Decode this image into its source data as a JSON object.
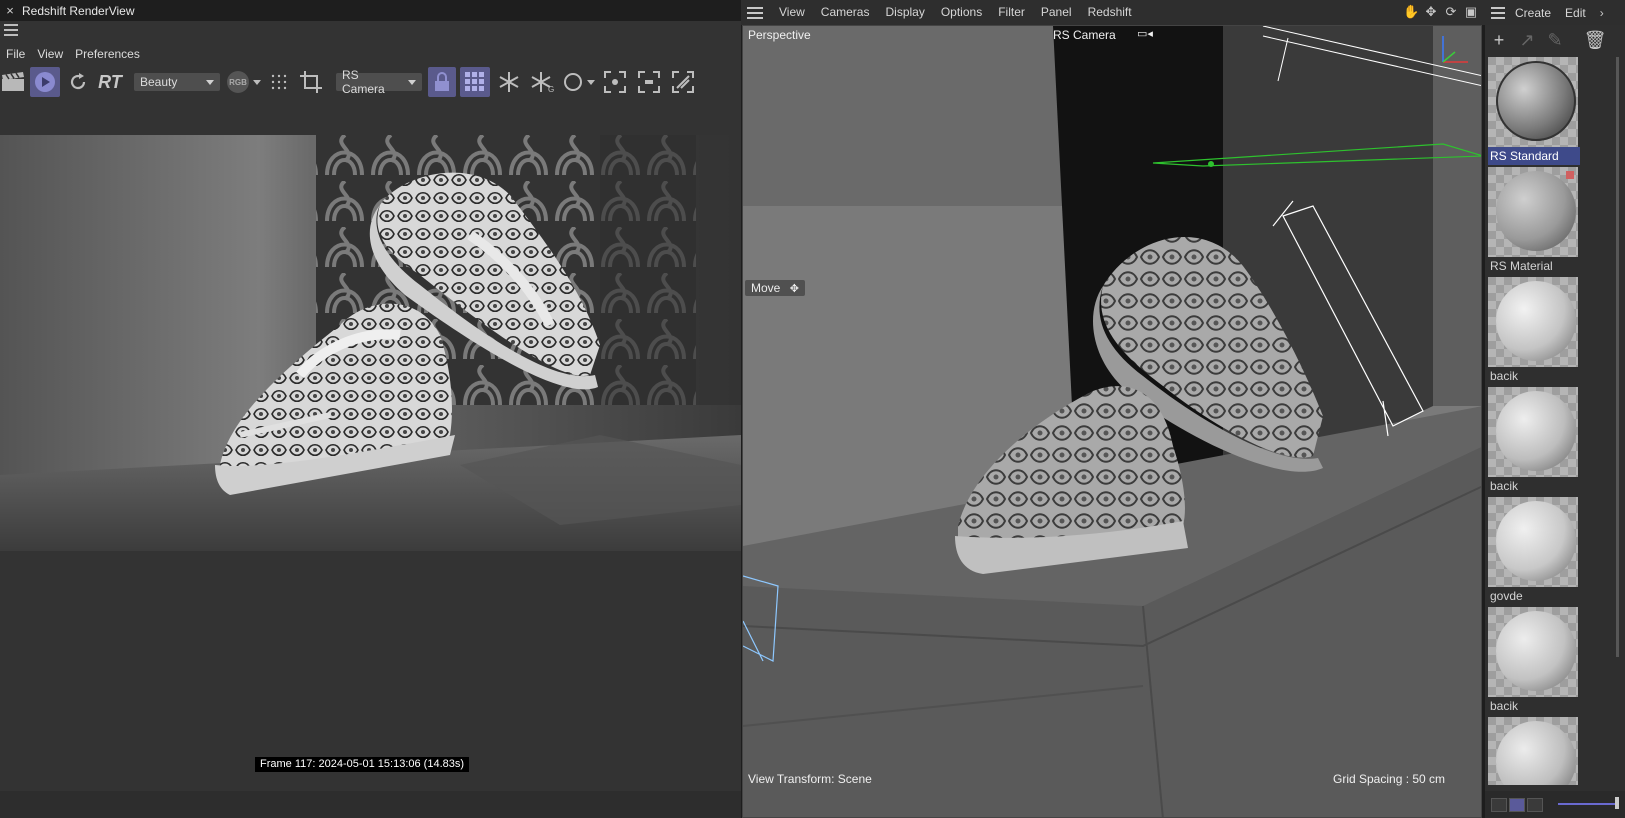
{
  "render_view": {
    "title": "Redshift RenderView",
    "menu": [
      "File",
      "View",
      "Preferences"
    ],
    "toolbar": {
      "aov_select": "Beauty",
      "rgb_badge": "RGB",
      "rt_label": "RT",
      "camera_select": "RS Camera"
    },
    "frame_info": "Frame  117:  2024-05-01  15:13:06  (14.83s)"
  },
  "viewport": {
    "menu": [
      "View",
      "Cameras",
      "Display",
      "Options",
      "Filter",
      "Panel",
      "Redshift"
    ],
    "view_name": "Perspective",
    "camera_name": "RS Camera",
    "tool_label": "Move",
    "view_transform": "View Transform: Scene",
    "grid_spacing": "Grid Spacing : 50 cm"
  },
  "material_manager": {
    "menu": [
      "Create",
      "Edit"
    ],
    "materials": [
      {
        "name": "RS Standard",
        "selected": true
      },
      {
        "name": "RS Material",
        "selected": false
      },
      {
        "name": "bacik",
        "selected": false
      },
      {
        "name": "bacik",
        "selected": false
      },
      {
        "name": "govde",
        "selected": false
      },
      {
        "name": "bacik",
        "selected": false
      },
      {
        "name": "",
        "selected": false
      }
    ]
  },
  "colors": {
    "accent": "#5a5a8c",
    "selection": "#3e4a8a",
    "panel_bg": "#333333"
  }
}
